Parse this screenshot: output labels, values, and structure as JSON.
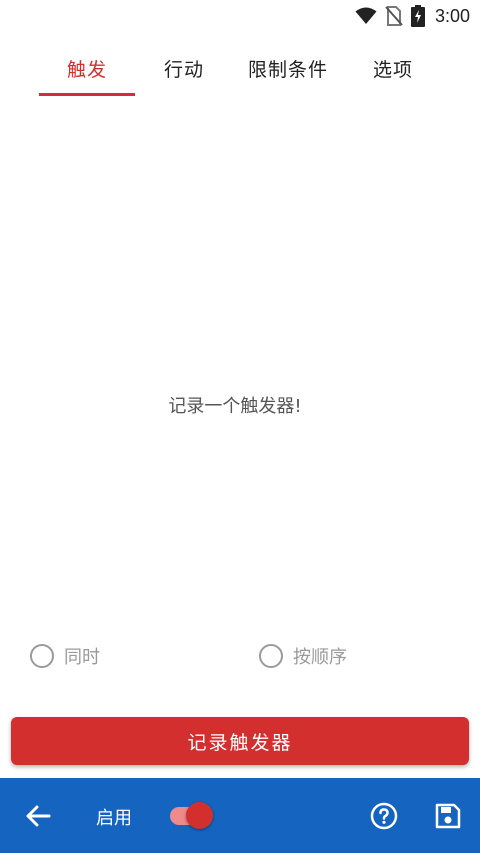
{
  "status_bar": {
    "time": "3:00",
    "icons": [
      "wifi-icon",
      "no-sim-icon",
      "battery-charging-icon"
    ]
  },
  "tabs": [
    {
      "label": "触发",
      "active": true
    },
    {
      "label": "行动",
      "active": false
    },
    {
      "label": "限制条件",
      "active": false
    },
    {
      "label": "选项",
      "active": false
    }
  ],
  "main": {
    "empty_message": "记录一个触发器!"
  },
  "options": {
    "radio_simultaneous": "同时",
    "radio_sequential": "按顺序"
  },
  "record_button": {
    "label": "记录触发器"
  },
  "bottom_bar": {
    "enable_label": "启用",
    "enabled": true,
    "icons": [
      "back-arrow-icon",
      "help-icon",
      "save-icon"
    ]
  },
  "colors": {
    "accent": "#d32f2f",
    "bottom_bar": "#1565c0",
    "toggle_track": "#ef8a8a"
  }
}
